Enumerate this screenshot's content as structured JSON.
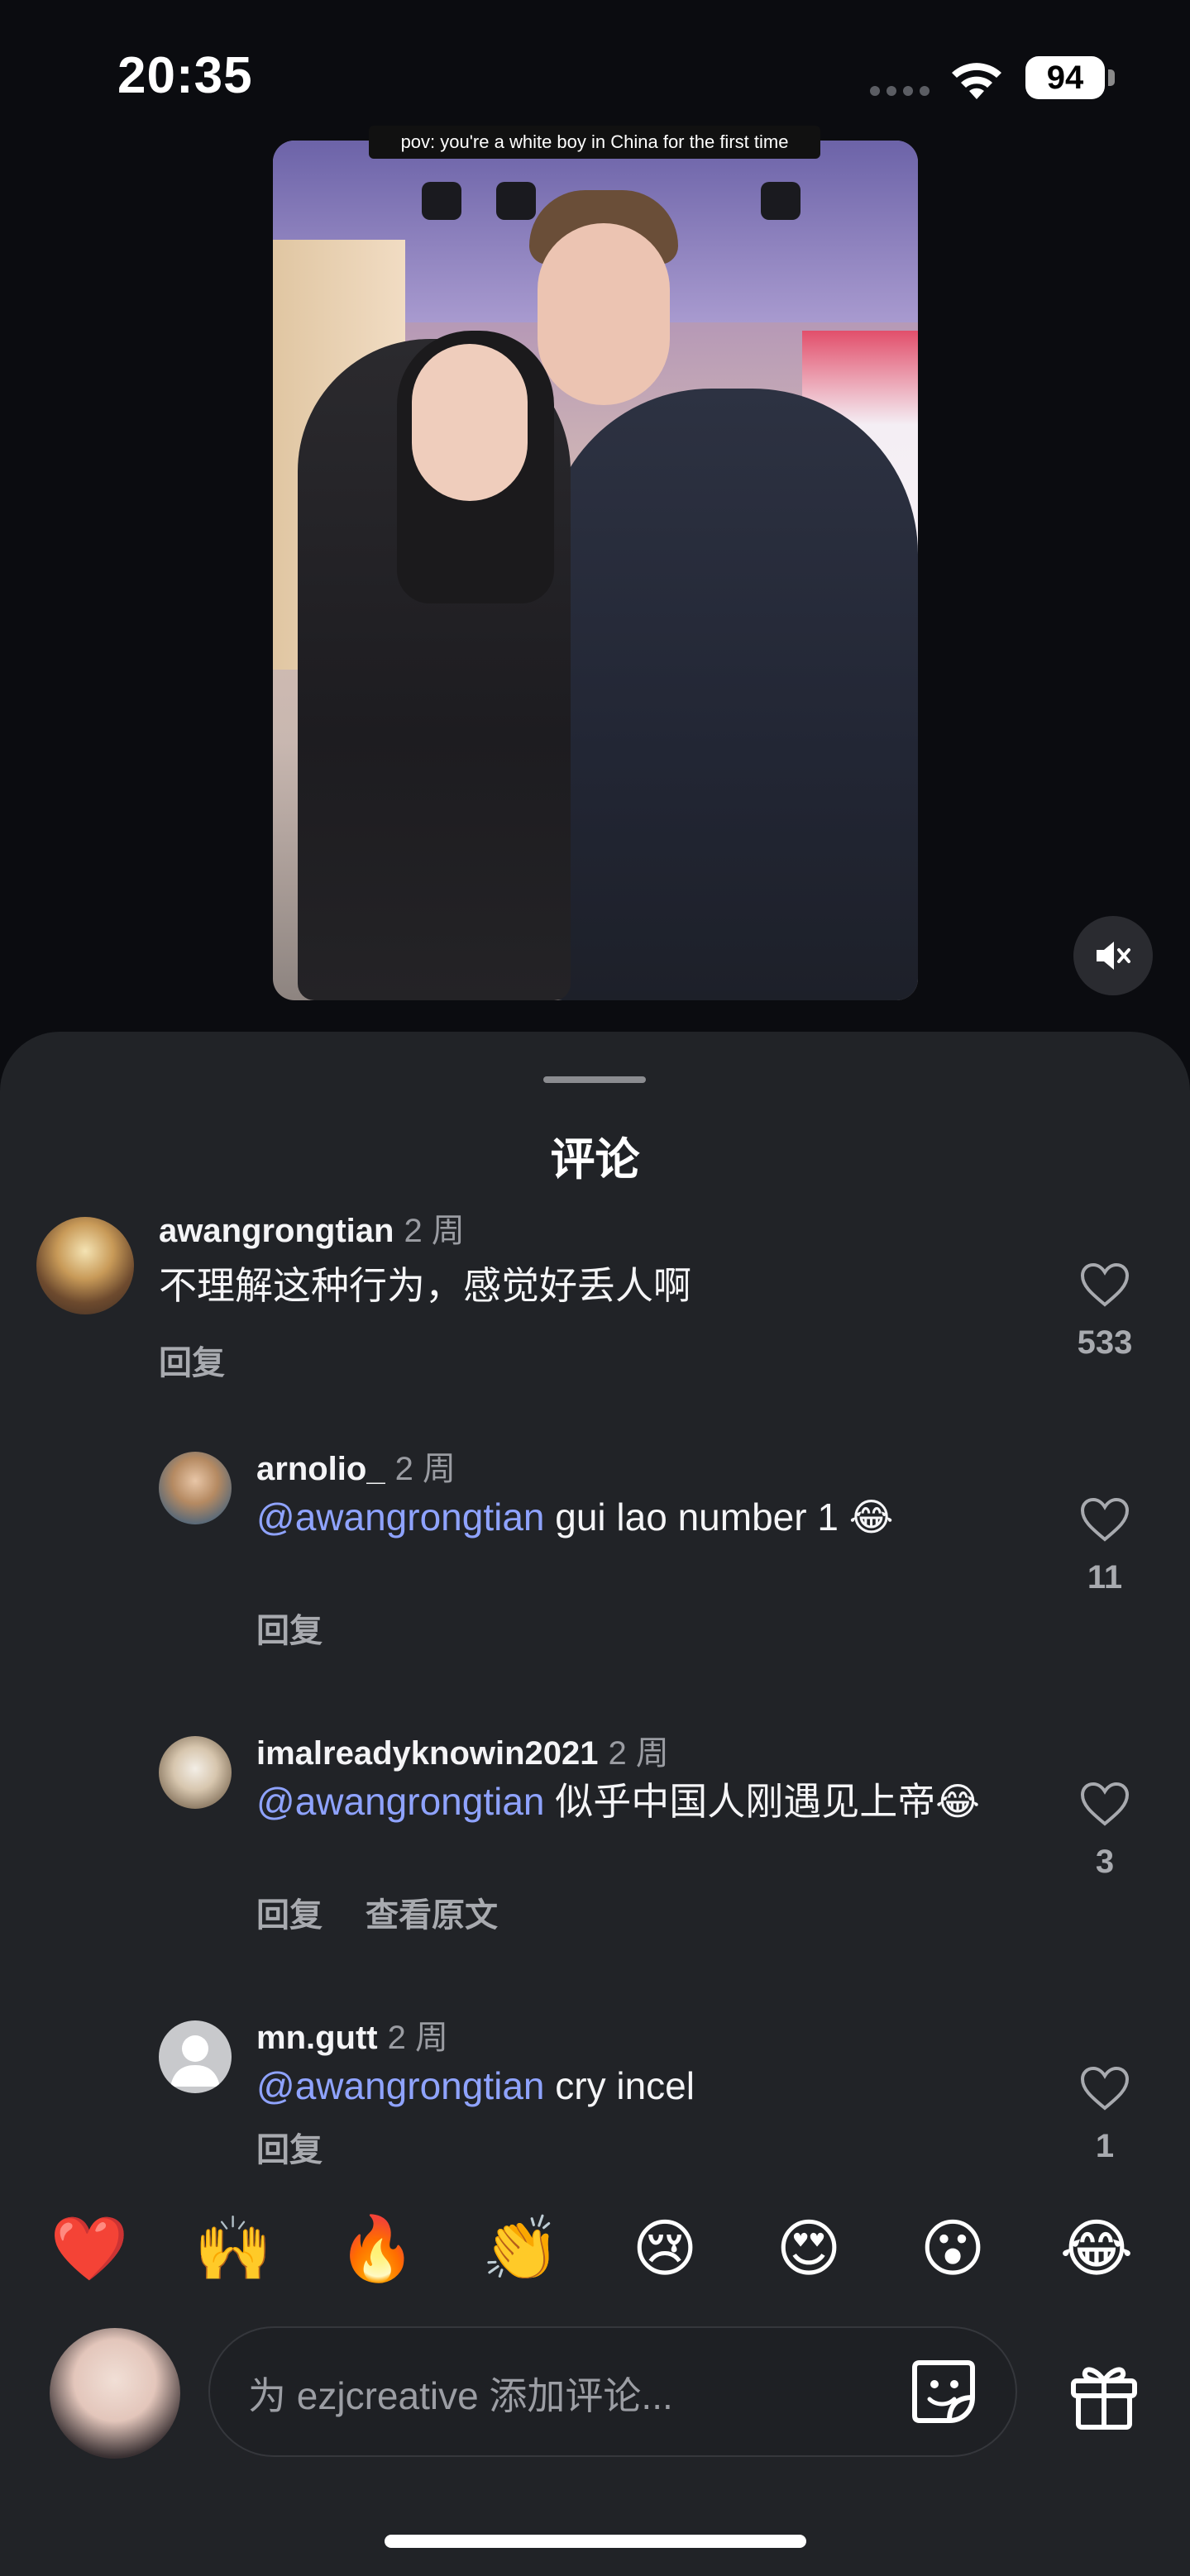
{
  "status_bar": {
    "time": "20:35",
    "battery": "94"
  },
  "video": {
    "caption": "pov: you're a white boy in China for the first time",
    "mute_icon": "speaker-muted-icon"
  },
  "sheet": {
    "title": "评论"
  },
  "comments": [
    {
      "username": "awangrongtian",
      "time": "2 周",
      "text": "不理解这种行为，感觉好丢人啊",
      "actions": [
        "回复"
      ],
      "likes": "533"
    },
    {
      "username": "arnolio_",
      "time": "2 周",
      "mention": "@awangrongtian",
      "text": " gui lao number 1 ",
      "emoji": "😂",
      "actions": [
        "回复"
      ],
      "likes": "11"
    },
    {
      "username": "imalreadyknowin2021",
      "time": "2 周",
      "mention": "@awangrongtian",
      "text": " 似乎中国人刚遇见上帝",
      "emoji": "😂",
      "actions": [
        "回复",
        "查看原文"
      ],
      "likes": "3"
    },
    {
      "username": "mn.gutt",
      "time": "2 周",
      "mention": "@awangrongtian",
      "text": " cry incel",
      "actions": [
        "回复"
      ],
      "likes": "1"
    }
  ],
  "quick_reactions": [
    "❤️",
    "🙌",
    "🔥",
    "👏",
    "😢",
    "😍",
    "😮",
    "😂"
  ],
  "composer": {
    "placeholder": "为 ezjcreative 添加评论...",
    "sticker_icon": "sticker-icon",
    "gift_icon": "gift-icon"
  },
  "colors": {
    "background": "#0b0c10",
    "sheet": "#212327",
    "mention": "#8fa3ff",
    "muted_text": "#a8aaaf"
  }
}
